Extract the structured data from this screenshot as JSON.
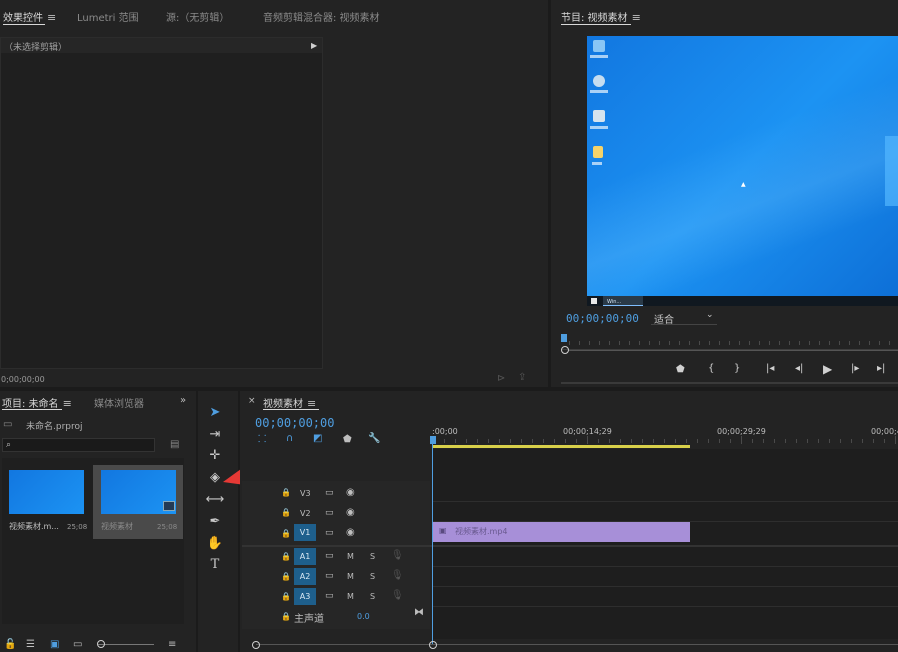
{
  "source_panel": {
    "tabs": [
      {
        "label": "效果控件",
        "active": true
      },
      {
        "label": "Lumetri 范围",
        "active": false
      },
      {
        "label": "源:（无剪辑）",
        "active": false
      },
      {
        "label": "音频剪辑混合器: 视频素材",
        "active": false
      }
    ],
    "no_clip_label": "（未选择剪辑）",
    "timecode": "0;00;00;00"
  },
  "program_monitor": {
    "title": "节目: 视频素材",
    "timecode": "00;00;00;00",
    "fit_select": "适合",
    "desktop_task": "Win..."
  },
  "project_panel": {
    "tabs": [
      {
        "label": "项目: 未命名",
        "active": true
      },
      {
        "label": "媒体浏览器",
        "active": false
      }
    ],
    "project_file": "未命名.prproj",
    "search_placeholder": "",
    "items": [
      {
        "name": "视频素材.m...",
        "duration": "25;08"
      },
      {
        "name": "视频素材",
        "duration": "25;08"
      }
    ]
  },
  "timeline": {
    "tab_label": "视频素材",
    "timecode": "00;00;00;00",
    "ruler_labels": [
      ":00;00",
      "00;00;14;29",
      "00;00;29;29",
      "00;00;4"
    ],
    "tracks": {
      "video": [
        {
          "label": "V3",
          "target": false
        },
        {
          "label": "V2",
          "target": false
        },
        {
          "label": "V1",
          "target": true
        }
      ],
      "audio": [
        {
          "label": "A1"
        },
        {
          "label": "A2"
        },
        {
          "label": "A3"
        }
      ],
      "master_label": "主声道",
      "master_value": "0.0",
      "mute": "M",
      "solo": "S"
    },
    "clip": {
      "name": "视频素材.mp4",
      "color": "#a78fd8"
    }
  },
  "tools": [
    "selection-tool",
    "track-select-tool",
    "ripple-edit-tool",
    "razor-tool",
    "slip-tool",
    "pen-tool",
    "hand-tool",
    "type-tool"
  ],
  "colors": {
    "accent": "#4f9ee0",
    "clip": "#a78fd8",
    "arrow": "#e53935",
    "desktop": "#1a8cf0"
  }
}
